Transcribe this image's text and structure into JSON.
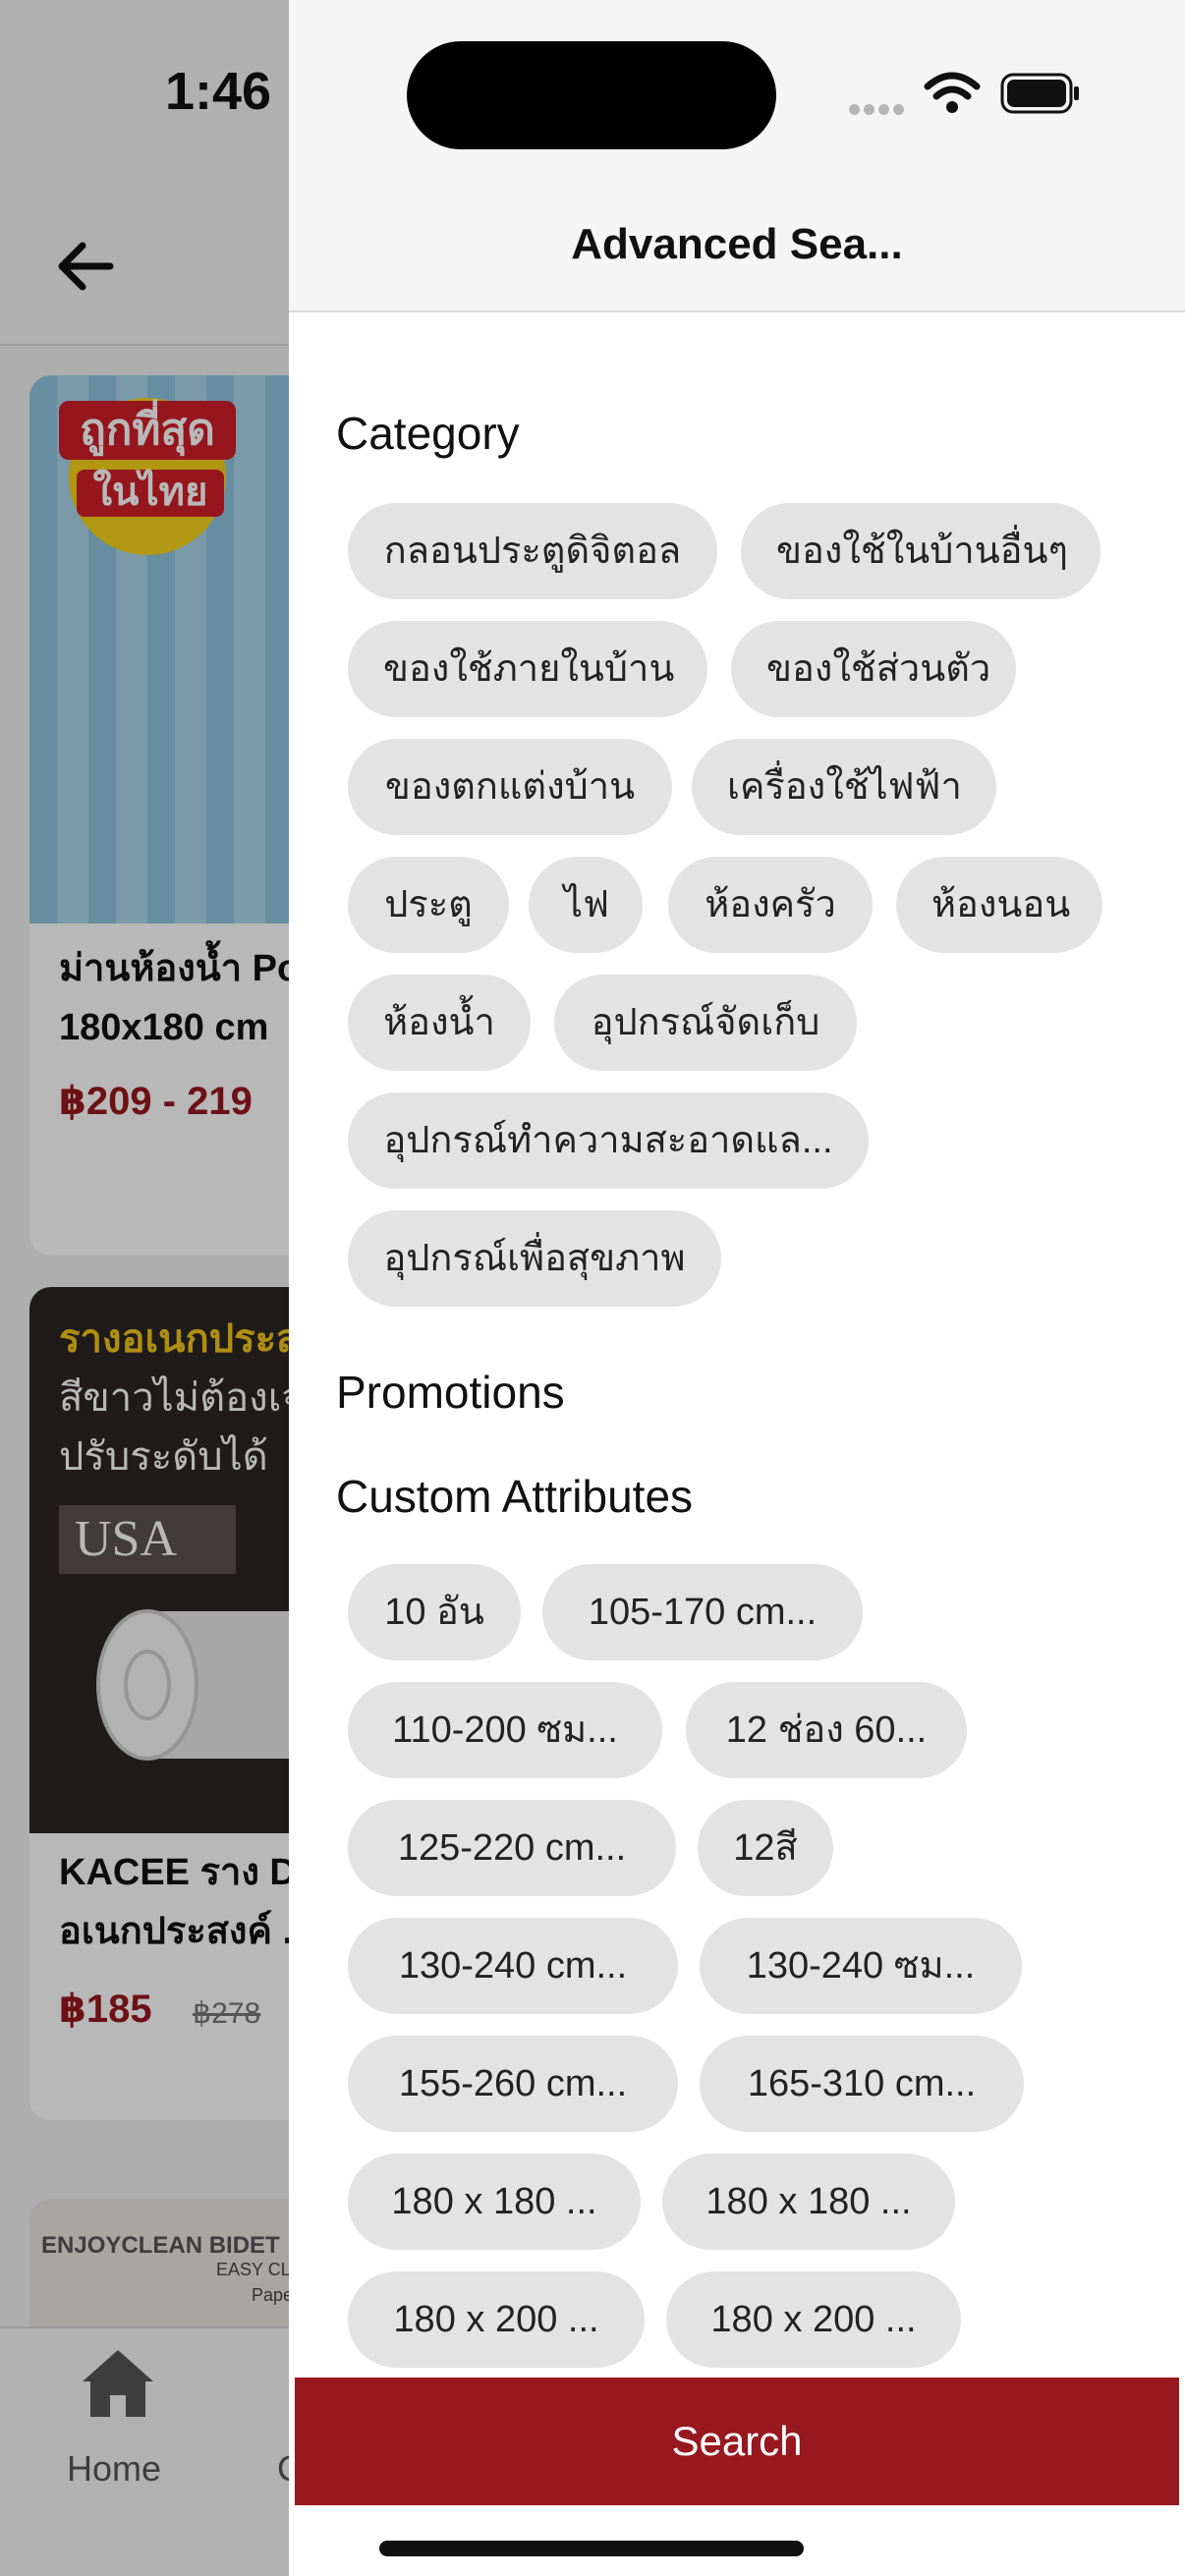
{
  "status_bar": {
    "time": "1:46"
  },
  "background": {
    "cards": [
      {
        "title_line1": "ม่านห้องน้ำ Po",
        "title_line2": "180x180 cm",
        "price": "฿209 - 219",
        "badge_line1": "ถูกที่สุด",
        "badge_line2": "ในไทย"
      },
      {
        "title_line1": "KACEE ราง D",
        "title_line2": "อเนกประสงค์ ...",
        "price": "฿185",
        "old_price": "฿278",
        "banner_line1": "รางอเนกประส",
        "banner_line2": "สีขาวไม่ต้องเจ",
        "banner_line3": "ปรับระดับได้",
        "banner_tag": "USA"
      },
      {
        "banner_line1": "ENJOYCLEAN BIDET",
        "banner_line2": "EASY CLEA",
        "banner_line3": "Paper W"
      }
    ],
    "tabbar": {
      "home_label": "Home",
      "next_label": "C"
    }
  },
  "drawer": {
    "title": "Advanced Sea...",
    "category_title": "Category",
    "categories": [
      "กลอนประตูดิจิตอล",
      "ของใช้ในบ้านอื่นๆ",
      "ของใช้ภายในบ้าน",
      "ของใช้ส่วนตัว",
      "ของตกแต่งบ้าน",
      "เครื่องใช้ไฟฟ้า",
      "ประตู",
      "ไฟ",
      "ห้องครัว",
      "ห้องนอน",
      "ห้องน้ำ",
      "อุปกรณ์จัดเก็บ",
      "อุปกรณ์ทำความสะอาดแล...",
      "อุปกรณ์เพื่อสุขภาพ"
    ],
    "promotions_title": "Promotions",
    "custom_attributes_title": "Custom Attributes",
    "attributes": [
      "10 อัน",
      "105-170 cm...",
      "110-200 ซม...",
      "12 ช่อง 60...",
      "125-220 cm...",
      "12สี",
      "130-240 cm...",
      "130-240 ซม...",
      "155-260 cm...",
      "165-310 cm...",
      "180 x 180 ...",
      "180 x 180 ...",
      "180 x 200 ...",
      "180 x 200 ..."
    ],
    "search_label": "Search"
  },
  "colors": {
    "accent": "#98181f",
    "chip_bg": "#e3e3e3"
  }
}
